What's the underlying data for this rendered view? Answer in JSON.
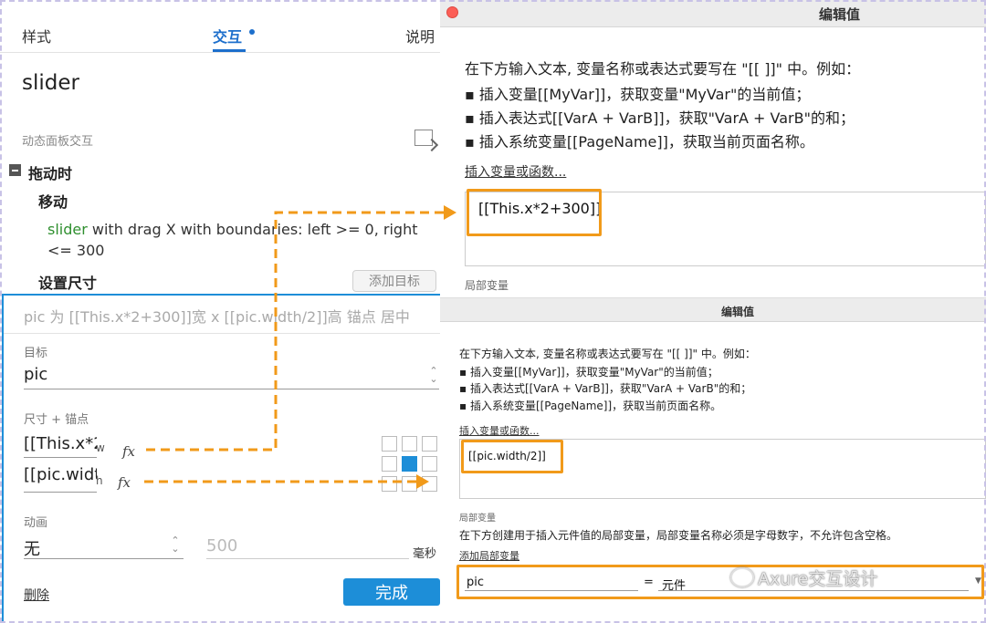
{
  "tabs": {
    "style": "样式",
    "interaction": "交互",
    "description": "说明"
  },
  "widget": {
    "name": "slider"
  },
  "section": {
    "label": "动态面板交互"
  },
  "event": {
    "title": "拖动时",
    "action1": "移动",
    "action1_target": "slider",
    "action1_desc": " with drag X  with boundaries: left >= 0, right <= 300",
    "action2": "设置尺寸",
    "add_target": "添加目标"
  },
  "editor": {
    "summary": "pic 为 [[This.x*2+300]]宽 x [[pic.width/2]]高  锚点 居中",
    "target_label": "目标",
    "target_value": "pic",
    "size_label": "尺寸 + 锚点",
    "width_value": "[[This.x*2+300]]",
    "width_suffix": "w",
    "height_value": "[[pic.width/2]]",
    "height_suffix": "h",
    "fx": "fx",
    "anim_label": "动画",
    "anim_value": "无",
    "duration_value": "500",
    "duration_unit": "毫秒",
    "delete": "删除",
    "done": "完成"
  },
  "dialog1": {
    "title": "编辑值",
    "intro": "在下方输入文本, 变量名称或表达式要写在 \"[[ ]]\" 中。例如：",
    "bullets": [
      "▪ 插入变量[[MyVar]]，获取变量\"MyVar\"的当前值；",
      "▪ 插入表达式[[VarA + VarB]]，获取\"VarA + VarB\"的和；",
      "▪ 插入系统变量[[PageName]]，获取当前页面名称。"
    ],
    "insert_link": "插入变量或函数...",
    "value": "[[This.x*2+300]]",
    "local_label": "局部变量"
  },
  "dialog2": {
    "title": "编辑值",
    "intro": "在下方输入文本, 变量名称或表达式要写在 \"[[ ]]\" 中。例如：",
    "bullets": [
      "▪ 插入变量[[MyVar]]，获取变量\"MyVar\"的当前值；",
      "▪ 插入表达式[[VarA + VarB]]，获取\"VarA + VarB\"的和；",
      "▪ 插入系统变量[[PageName]]，获取当前页面名称。"
    ],
    "insert_link": "插入变量或函数...",
    "value": "[[pic.width/2]]",
    "local_label": "局部变量",
    "local_desc": "在下方创建用于插入元件值的局部变量，局部变量名称必须是字母数字，不允许包含空格。",
    "add_local": "添加局部变量",
    "var_name": "pic",
    "equals": "=",
    "var_type": "元件"
  },
  "watermark": "Axure交互设计",
  "colors": {
    "accent": "#1d8ed8",
    "highlight": "#f19a1a",
    "close": "#fc5f57"
  }
}
